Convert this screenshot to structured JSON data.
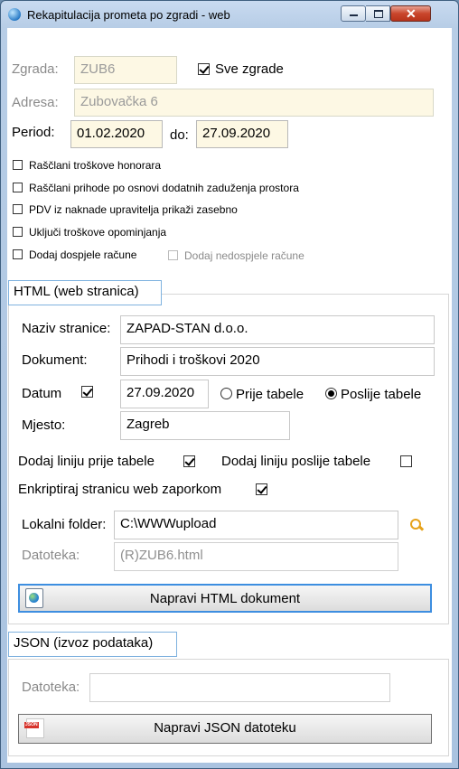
{
  "window": {
    "title": "Rekapitulacija prometa po zgradi - web"
  },
  "building": {
    "zgrada_label": "Zgrada:",
    "zgrada_value": "ZUB6",
    "sve_zgrade_label": "Sve zgrade",
    "sve_zgrade_checked": true,
    "adresa_label": "Adresa:",
    "adresa_value": "Zubovačka 6",
    "period_label": "Period:",
    "period_from": "01.02.2020",
    "do_label": "do:",
    "period_to": "27.09.2020"
  },
  "options": [
    {
      "label": "Raščlani troškove honorara",
      "checked": false
    },
    {
      "label": "Raščlani prihode po osnovi dodatnih zaduženja prostora",
      "checked": false
    },
    {
      "label": "PDV iz naknade upravitelja prikaži zasebno",
      "checked": false
    },
    {
      "label": "Uključi troškove opominjanja",
      "checked": false
    },
    {
      "label": "Dodaj dospjele račune",
      "checked": false
    },
    {
      "label": "Dodaj nedospjele račune",
      "checked": false,
      "disabled": true
    }
  ],
  "html_section": {
    "tab_label": "HTML (web stranica)",
    "naziv_label": "Naziv stranice:",
    "naziv_value": "ZAPAD-STAN d.o.o.",
    "dokument_label": "Dokument:",
    "dokument_value": "Prihodi i troškovi 2020",
    "datum_label": "Datum",
    "datum_checked": true,
    "datum_value": "27.09.2020",
    "prije_label": "Prije tabele",
    "poslije_label": "Poslije tabele",
    "position_selected": "Poslije tabele",
    "mjesto_label": "Mjesto:",
    "mjesto_value": "Zagreb",
    "liniju_prije_label": "Dodaj liniju prije tabele",
    "liniju_prije_checked": true,
    "liniju_poslije_label": "Dodaj liniju poslije tabele",
    "liniju_poslije_checked": false,
    "enkriptiraj_label": "Enkriptiraj stranicu web zaporkom",
    "enkriptiraj_checked": true,
    "folder_label": "Lokalni folder:",
    "folder_value": "C:\\WWWupload",
    "datoteka_label": "Datoteka:",
    "datoteka_value": "(R)ZUB6.html",
    "button_label": "Napravi HTML dokument"
  },
  "json_section": {
    "tab_label": "JSON (izvoz podataka)",
    "datoteka_label": "Datoteka:",
    "datoteka_value": "",
    "button_label": "Napravi JSON datoteku"
  },
  "icons": {
    "app": "globe-icon",
    "search": "search-folder-icon",
    "html_button": "html-document-icon",
    "json_button": "json-file-icon"
  },
  "colors": {
    "readonly_bg": "#fdf8e4",
    "tab_border": "#7fb2df",
    "focus_border": "#3d8ee0",
    "close_button": "#c9462c"
  }
}
